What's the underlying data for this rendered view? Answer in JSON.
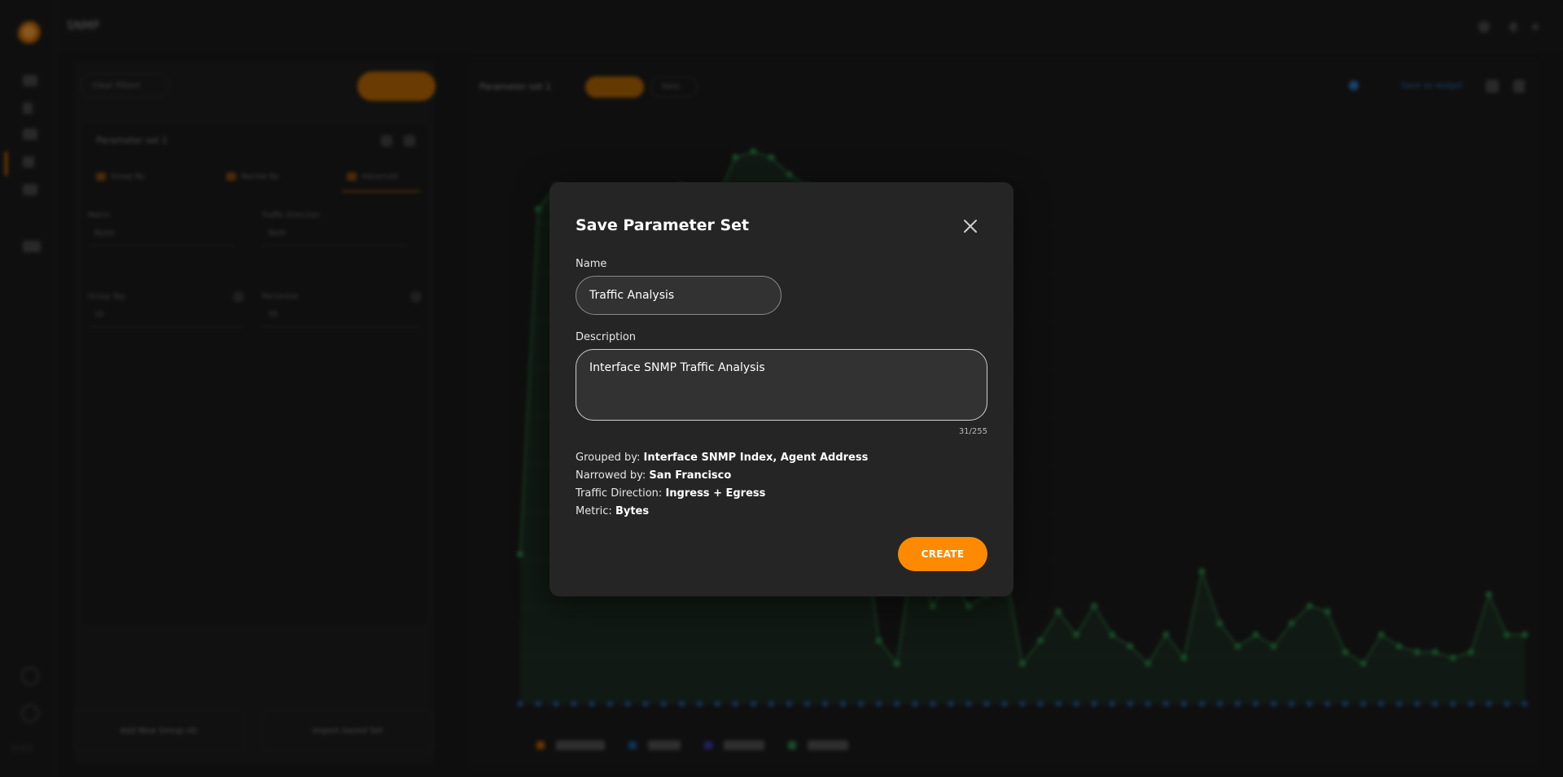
{
  "app": {
    "title": "SNMP",
    "version": "v1.0.0"
  },
  "left_panel": {
    "clear_filters_label": "Clear Filters",
    "header": "Parameter set 1",
    "tabs": [
      {
        "label": "Group By"
      },
      {
        "label": "Narrow By"
      },
      {
        "label": "Advanced"
      }
    ],
    "fields": {
      "metric_label": "Metric",
      "metric_value": "Bytes",
      "traffic_label": "Traffic Direction",
      "traffic_value": "Both",
      "group_top_label": "Group Top",
      "group_top_value": "10",
      "percentile_label": "Percentile",
      "percentile_value": "95"
    },
    "add_group_label": "Add New Group (4)",
    "import_label": "Import Saved Set"
  },
  "chart_panel": {
    "parameter_set_label": "Parameter set 1",
    "view_pill_2": "Table",
    "link_label": "Save as widget"
  },
  "chart_data": {
    "type": "area",
    "values": [
      0.26,
      0.86,
      0.9,
      0.85,
      0.83,
      0.88,
      0.82,
      0.8,
      0.75,
      0.9,
      0.86,
      0.88,
      0.95,
      0.96,
      0.95,
      0.92,
      0.9,
      0.88,
      0.2,
      0.35,
      0.11,
      0.07,
      0.28,
      0.17,
      0.22,
      0.17,
      0.19,
      0.24,
      0.07,
      0.11,
      0.16,
      0.12,
      0.17,
      0.12,
      0.1,
      0.07,
      0.12,
      0.08,
      0.23,
      0.14,
      0.1,
      0.12,
      0.1,
      0.14,
      0.17,
      0.16,
      0.09,
      0.07,
      0.12,
      0.1,
      0.09,
      0.09,
      0.08,
      0.09,
      0.19,
      0.12,
      0.12
    ],
    "grid": true,
    "legend": "bottom",
    "color": "#2e8b4a"
  },
  "modal": {
    "title": "Save Parameter Set",
    "name_label": "Name",
    "name_value": "Traffic Analysis",
    "description_label": "Description",
    "description_value": "Interface SNMP Traffic Analysis",
    "char_count": "31/255",
    "summary": [
      {
        "label": "Grouped by: ",
        "value": "Interface SNMP Index, Agent Address"
      },
      {
        "label": "Narrowed by: ",
        "value": "San Francisco"
      },
      {
        "label": "Traffic Direction: ",
        "value": "Ingress + Egress"
      },
      {
        "label": "Metric: ",
        "value": "Bytes"
      }
    ],
    "create_label": "CREATE",
    "colors": {
      "accent": "#ff8a00",
      "surface": "#252525"
    }
  }
}
